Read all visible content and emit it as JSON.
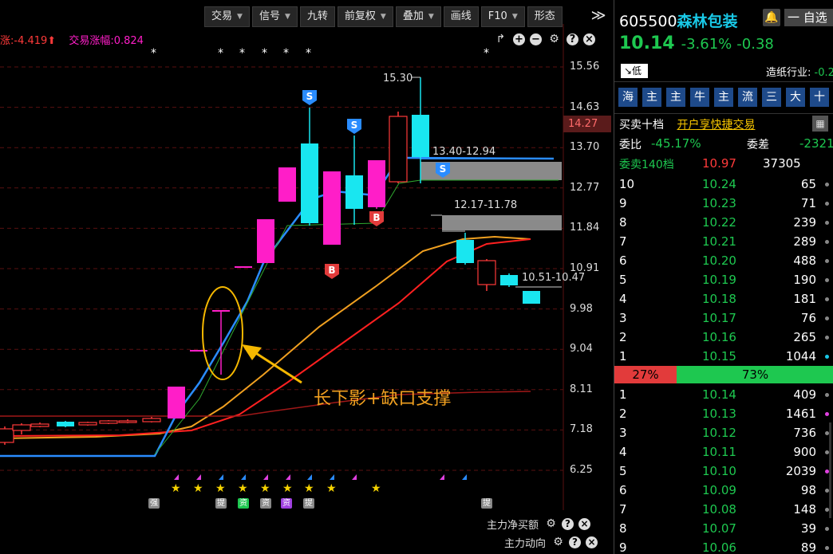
{
  "toolbar": {
    "buttons": [
      {
        "label": "交易",
        "caret": true
      },
      {
        "label": "信号",
        "caret": true
      },
      {
        "label": "九转",
        "caret": false
      },
      {
        "label": "前复权",
        "caret": true
      },
      {
        "label": "叠加",
        "caret": true
      },
      {
        "label": "画线",
        "caret": false
      },
      {
        "label": "F10",
        "caret": true
      },
      {
        "label": "形态",
        "caret": false
      }
    ],
    "more": "≫"
  },
  "indicator": {
    "item1": "涨:-4.419",
    "item1_arrow": "⬆",
    "item2": "交易涨幅:0.824"
  },
  "chart": {
    "price_axis": [
      "15.56",
      "14.63",
      "13.70",
      "12.77",
      "11.84",
      "10.91",
      "9.98",
      "9.04",
      "8.11",
      "7.18",
      "6.25"
    ],
    "current_price": "14.27",
    "high_label": "15.30",
    "zone1_label": "13.40-12.94",
    "zone2_label": "12.17-11.78",
    "zone3_label": "10.51-10.47",
    "annotation": "长下影+缺口支撑",
    "signal_S": "S",
    "signal_B": "B",
    "asterisk": "*",
    "star": "★",
    "bottom_marks": [
      "强",
      "提",
      "资",
      "资",
      "资",
      "提",
      "提"
    ]
  },
  "bottom_rows": [
    {
      "label": "主力净买额"
    },
    {
      "label": "主力动向"
    }
  ],
  "stock": {
    "code": "605500",
    "name": "森林包装",
    "bell": "🔔",
    "selfpick": "一 自选",
    "price": "10.14",
    "change_pct": "-3.61%",
    "change": "-0.38",
    "low_badge": "↘低",
    "industry_label": "造纸行业:",
    "industry_value": "-0.2"
  },
  "tags": [
    "海",
    "主",
    "主",
    "牛",
    "主",
    "流",
    "三",
    "大",
    "十"
  ],
  "orderbook": {
    "title": "买卖十档",
    "trade_link": "开户享快捷交易",
    "weibi_label": "委比",
    "weibi_value": "-45.17%",
    "weicha_label": "委差",
    "weicha_value": "-2321",
    "sell_header_label": "委卖140档",
    "sell_header_price": "10.97",
    "sell_header_vol": "37305",
    "sells": [
      {
        "lvl": "10",
        "price": "10.24",
        "vol": "65",
        "dot": "#888"
      },
      {
        "lvl": "9",
        "price": "10.23",
        "vol": "71",
        "dot": "#888"
      },
      {
        "lvl": "8",
        "price": "10.22",
        "vol": "239",
        "dot": "#888"
      },
      {
        "lvl": "7",
        "price": "10.21",
        "vol": "289",
        "dot": "#888"
      },
      {
        "lvl": "6",
        "price": "10.20",
        "vol": "488",
        "dot": "#888"
      },
      {
        "lvl": "5",
        "price": "10.19",
        "vol": "190",
        "dot": "#888"
      },
      {
        "lvl": "4",
        "price": "10.18",
        "vol": "181",
        "dot": "#888"
      },
      {
        "lvl": "3",
        "price": "10.17",
        "vol": "76",
        "dot": "#888"
      },
      {
        "lvl": "2",
        "price": "10.16",
        "vol": "265",
        "dot": "#888"
      },
      {
        "lvl": "1",
        "price": "10.15",
        "vol": "1044",
        "dot": "#19c8e6"
      }
    ],
    "buy_pct": "27%",
    "sell_pct": "73%",
    "buys": [
      {
        "lvl": "1",
        "price": "10.14",
        "vol": "409",
        "dot": "#888"
      },
      {
        "lvl": "2",
        "price": "10.13",
        "vol": "1461",
        "dot": "#e040e0"
      },
      {
        "lvl": "3",
        "price": "10.12",
        "vol": "736",
        "dot": "#888"
      },
      {
        "lvl": "4",
        "price": "10.11",
        "vol": "900",
        "dot": "#888"
      },
      {
        "lvl": "5",
        "price": "10.10",
        "vol": "2039",
        "dot": "#e040e0"
      },
      {
        "lvl": "6",
        "price": "10.09",
        "vol": "98",
        "dot": "#888"
      },
      {
        "lvl": "7",
        "price": "10.08",
        "vol": "148",
        "dot": "#888"
      },
      {
        "lvl": "8",
        "price": "10.07",
        "vol": "39",
        "dot": "#888"
      },
      {
        "lvl": "9",
        "price": "10.06",
        "vol": "89",
        "dot": "#888"
      }
    ]
  },
  "colors": {
    "up": "#ff3a3a",
    "down": "#1ec850",
    "cyan": "#19e6f0",
    "magenta": "#ff1ec8",
    "ma_blue": "#2a8cff",
    "ma_orange": "#f0a020",
    "ma_red": "#ff2020"
  }
}
